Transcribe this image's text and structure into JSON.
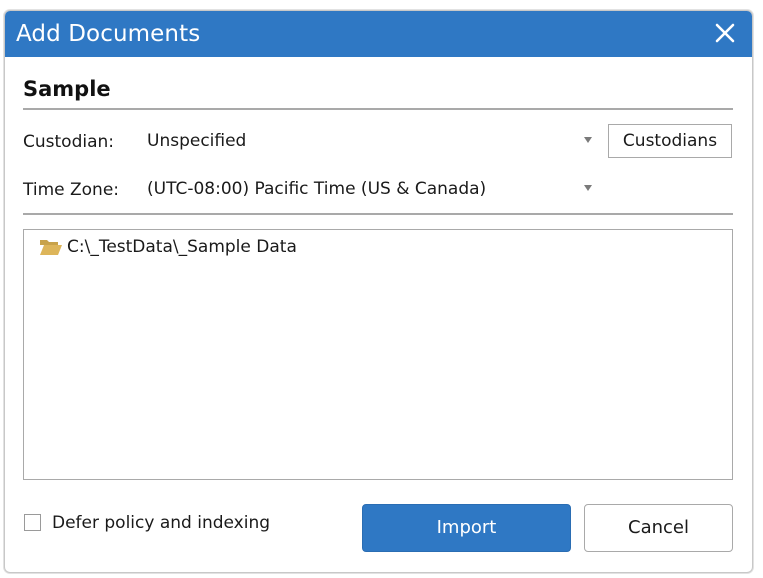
{
  "dialog": {
    "title": "Add Documents",
    "close_icon": "close-icon",
    "accent_color": "#2f78c4"
  },
  "section": {
    "title": "Sample"
  },
  "custodian": {
    "label": "Custodian:",
    "value": "Unspecified",
    "button_label": "Custodians"
  },
  "timezone": {
    "label": "Time Zone:",
    "value": "(UTC-08:00) Pacific Time (US & Canada)"
  },
  "files": [
    {
      "icon": "folder-open-icon",
      "path": "C:\\_TestData\\_Sample Data"
    }
  ],
  "options": {
    "defer_label": "Defer policy and indexing",
    "defer_checked": false
  },
  "actions": {
    "import_label": "Import",
    "cancel_label": "Cancel"
  }
}
